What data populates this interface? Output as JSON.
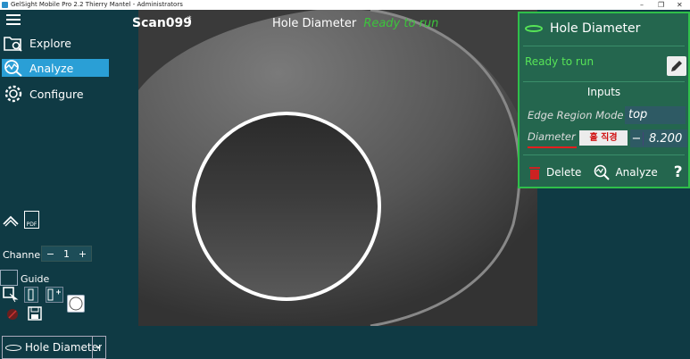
{
  "window": {
    "title": "GelSight Mobile Pro 2.2   Thierry Mantel - Administrators",
    "controls": [
      "–",
      "❐",
      "✕"
    ]
  },
  "nav": {
    "items": [
      {
        "label": "Explore",
        "icon": "explore-icon"
      },
      {
        "label": "Analyze",
        "icon": "analyze-icon",
        "active": true
      },
      {
        "label": "Configure",
        "icon": "gear-icon"
      }
    ]
  },
  "channel": {
    "label": "Channel",
    "minus": "−",
    "value": "1",
    "plus": "+"
  },
  "guide": {
    "label": "Guide"
  },
  "pdf_label": "PDF",
  "tool_select": {
    "value": "Hole Diameter",
    "arrow": "▸"
  },
  "scan": {
    "name": "Scan099",
    "modified_mark": "*"
  },
  "center": {
    "tool_name": "Hole Diameter",
    "status": "Ready to run"
  },
  "panel": {
    "title": "Hole Diameter",
    "status": "Ready to run",
    "inputs_heading": "Inputs",
    "edge_region_label": "Edge Region Mode",
    "edge_region_value": "top",
    "diameter_label": "Diameter",
    "diameter_annotation": "홀 직경",
    "diameter_minus": "−",
    "diameter_value": "8.200",
    "delete_label": "Delete",
    "analyze_label": "Analyze",
    "help_label": "?"
  },
  "colors": {
    "accent": "#2a9fd6",
    "panel_bg": "#24664e",
    "panel_border": "#2fbf4a",
    "status_green": "#57e457",
    "center_status": "#3cc43c",
    "annotation_red": "#d01010"
  }
}
